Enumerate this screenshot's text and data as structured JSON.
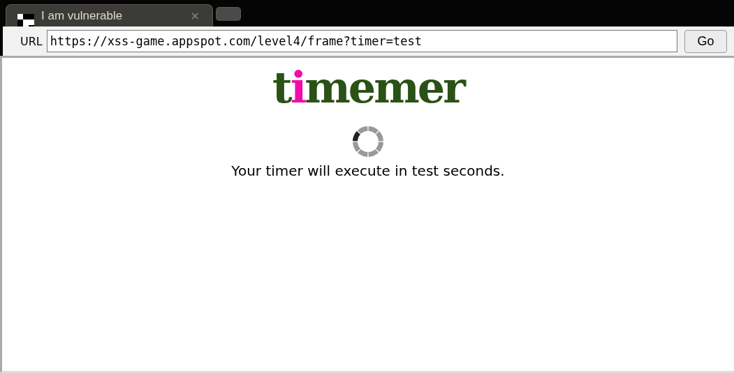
{
  "tabs": [
    {
      "title": "I am vulnerable",
      "selected": true,
      "close": "×"
    },
    {
      "selected": false
    }
  ],
  "address_bar": {
    "label": "URL",
    "value": "https://xss-game.appspot.com/level4/frame?timer=test",
    "button": "Go"
  },
  "page": {
    "logo": [
      {
        "text": "t",
        "color": "#2a5116"
      },
      {
        "text": "i",
        "color": "#ef0ea9"
      },
      {
        "text": "memer",
        "color": "#2a5116"
      }
    ],
    "message": "Your timer will execute in test seconds."
  }
}
